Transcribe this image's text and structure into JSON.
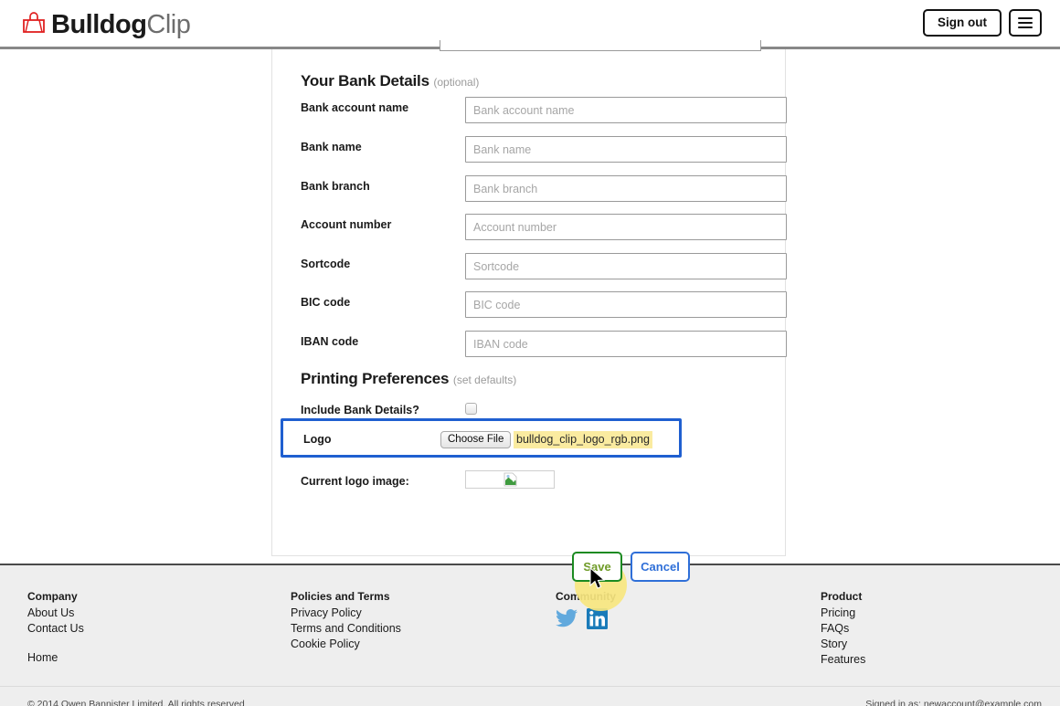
{
  "header": {
    "logo_bold": "Bulldog",
    "logo_light": "Clip",
    "signout_label": "Sign out",
    "menu_icon": "hamburger-menu-icon"
  },
  "form": {
    "bank_section": {
      "title": "Your Bank Details",
      "hint": "(optional)",
      "fields": [
        {
          "label": "Bank account name",
          "placeholder": "Bank account name",
          "value": ""
        },
        {
          "label": "Bank name",
          "placeholder": "Bank name",
          "value": ""
        },
        {
          "label": "Bank branch",
          "placeholder": "Bank branch",
          "value": ""
        },
        {
          "label": "Account number",
          "placeholder": "Account number",
          "value": ""
        },
        {
          "label": "Sortcode",
          "placeholder": "Sortcode",
          "value": ""
        },
        {
          "label": "BIC code",
          "placeholder": "BIC code",
          "value": ""
        },
        {
          "label": "IBAN code",
          "placeholder": "IBAN code",
          "value": ""
        }
      ]
    },
    "printing_section": {
      "title": "Printing Preferences",
      "hint": "(set defaults)",
      "include_bank_label": "Include Bank Details?",
      "include_bank_checked": false,
      "logo_label": "Logo",
      "choose_file_label": "Choose File",
      "selected_file": "bulldog_clip_logo_rgb.png",
      "current_logo_label": "Current logo image:",
      "current_logo_icon": "broken-image-icon"
    },
    "save_label": "Save",
    "cancel_label": "Cancel"
  },
  "highlight": {
    "logo_row_border_color": "#1f5fd0",
    "file_name_background": "#faeba0",
    "click_halo_color": "#f7e67f",
    "save_border_color": "#1b8a21"
  },
  "footer": {
    "columns": [
      {
        "heading": "Company",
        "links": [
          "About Us",
          "Contact Us"
        ],
        "extra_links": [
          "Home"
        ]
      },
      {
        "heading": "Policies and Terms",
        "links": [
          "Privacy Policy",
          "Terms and Conditions",
          "Cookie Policy"
        ],
        "extra_links": []
      },
      {
        "heading": "Community",
        "links": [],
        "extra_links": [],
        "social": [
          "twitter-icon",
          "linkedin-icon"
        ]
      },
      {
        "heading": "Product",
        "links": [
          "Pricing",
          "FAQs",
          "Story",
          "Features"
        ],
        "extra_links": []
      }
    ],
    "copyright": "© 2014 Owen Bannister Limited. All rights reserved",
    "signed_in_as": "Signed in as: newaccount@example.com"
  }
}
